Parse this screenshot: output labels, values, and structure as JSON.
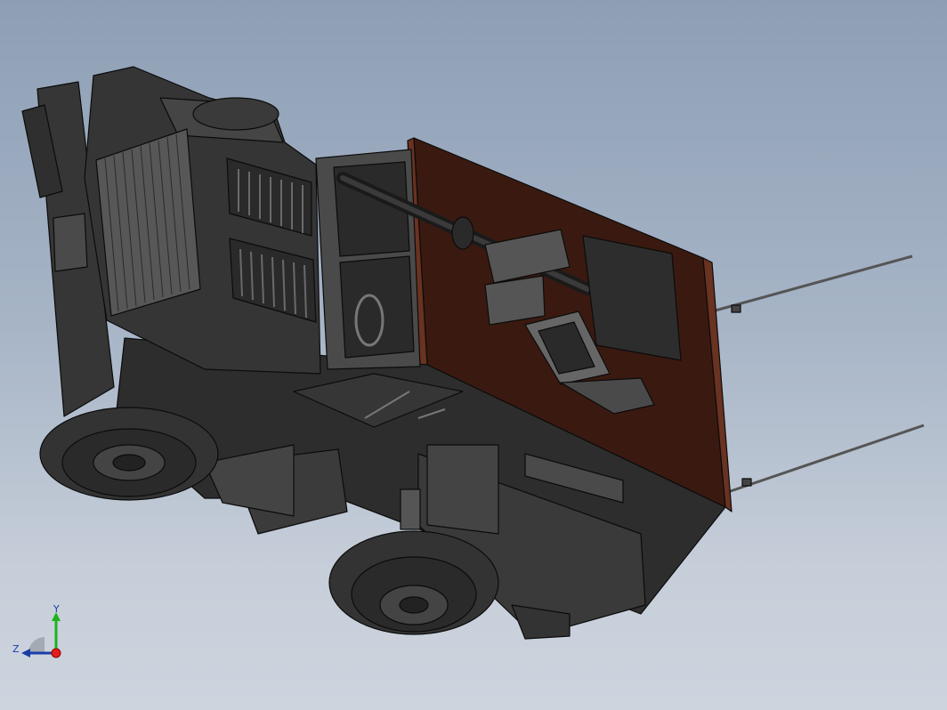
{
  "viewport": {
    "background_top": "#8e9fb5",
    "background_bottom": "#cdd4de"
  },
  "model": {
    "colors": {
      "body_dark": "#2b2b2b",
      "body_mid": "#3d3d3d",
      "body_light": "#575757",
      "edge": "#0b0b0b",
      "panel_wood": "#3a1a10",
      "panel_wood_edge": "#6a3220",
      "tire": "#333333",
      "rim": "#444444"
    }
  },
  "triad": {
    "y_label": "Y",
    "z_label": "Z",
    "y_color": "#1db31d",
    "z_color": "#1a3ea8",
    "origin_color": "#e0201c"
  }
}
